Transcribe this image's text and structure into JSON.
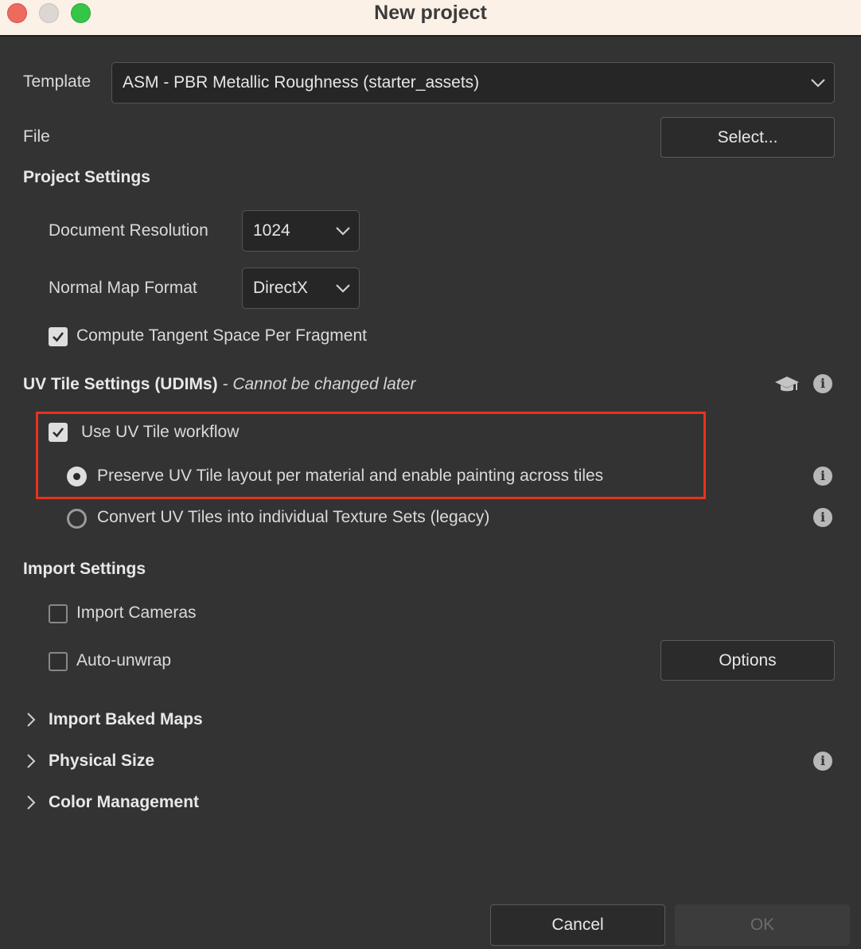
{
  "window": {
    "title": "New project",
    "traffic_lights": {
      "close_color": "#ee6a5f",
      "minimize_color": "#dcd7d2",
      "maximize_color": "#35c648"
    }
  },
  "template": {
    "label": "Template",
    "value": "ASM - PBR Metallic Roughness (starter_assets)"
  },
  "file": {
    "label": "File",
    "button": "Select..."
  },
  "project_settings": {
    "header": "Project Settings",
    "document_resolution": {
      "label": "Document Resolution",
      "value": "1024"
    },
    "normal_map_format": {
      "label": "Normal Map Format",
      "value": "DirectX"
    },
    "compute_tangent": {
      "label": "Compute Tangent Space Per Fragment",
      "checked": true
    }
  },
  "uv_tile_settings": {
    "header": "UV Tile Settings (UDIMs)",
    "separator": " - ",
    "note": "Cannot be changed later",
    "use_uv_tile": {
      "label": "Use UV Tile workflow",
      "checked": true
    },
    "options": [
      {
        "label": "Preserve UV Tile layout per material and enable painting across tiles",
        "selected": true
      },
      {
        "label": "Convert UV Tiles into individual Texture Sets (legacy)",
        "selected": false
      }
    ],
    "highlight_color": "#e8321f"
  },
  "import_settings": {
    "header": "Import Settings",
    "import_cameras": {
      "label": "Import Cameras",
      "checked": false
    },
    "auto_unwrap": {
      "label": "Auto-unwrap",
      "checked": false
    },
    "options_button": "Options"
  },
  "sections": [
    {
      "label": "Import Baked Maps",
      "has_info": false
    },
    {
      "label": "Physical Size",
      "has_info": true
    },
    {
      "label": "Color Management",
      "has_info": false
    }
  ],
  "footer": {
    "cancel": "Cancel",
    "ok": "OK",
    "ok_enabled": false
  },
  "icons": {
    "info_glyph": "i",
    "graduation_cap": "graduation-cap-icon"
  }
}
